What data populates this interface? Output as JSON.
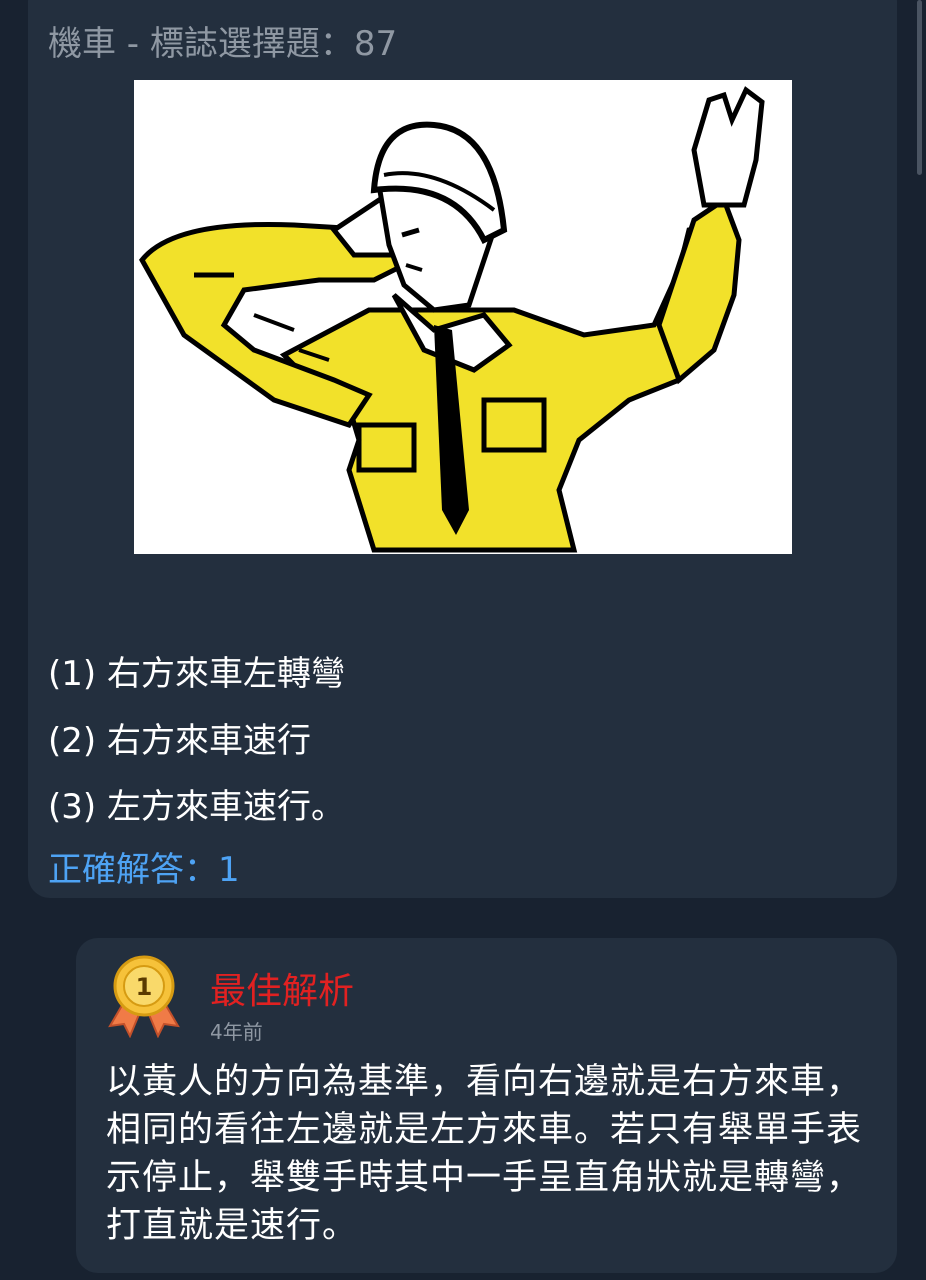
{
  "question": {
    "title": "機車 - 標誌選擇題：87",
    "options": [
      "(1) 右方來車左轉彎",
      "(2) 右方來車速行",
      "(3) 左方來車速行。"
    ],
    "answer": "正確解答：1",
    "image_icon": "traffic-officer-hand-signal-illustration"
  },
  "analysis": {
    "badge_icon": "first-place-medal-icon",
    "badge_number": "1",
    "title": "最佳解析",
    "time": "4年前",
    "body": "以黃人的方向為基準，看向右邊就是右方來車，相同的看往左邊就是左方來車。若只有舉單手表示停止，舉雙手時其中一手呈直角狀就是轉彎，打直就是速行。"
  },
  "colors": {
    "page_bg": "#182230",
    "card_bg": "#232f3e",
    "title_gray": "#8f98a3",
    "answer_blue": "#4ea3f4",
    "analysis_red": "#e12121",
    "jacket_yellow": "#f2e12a"
  }
}
